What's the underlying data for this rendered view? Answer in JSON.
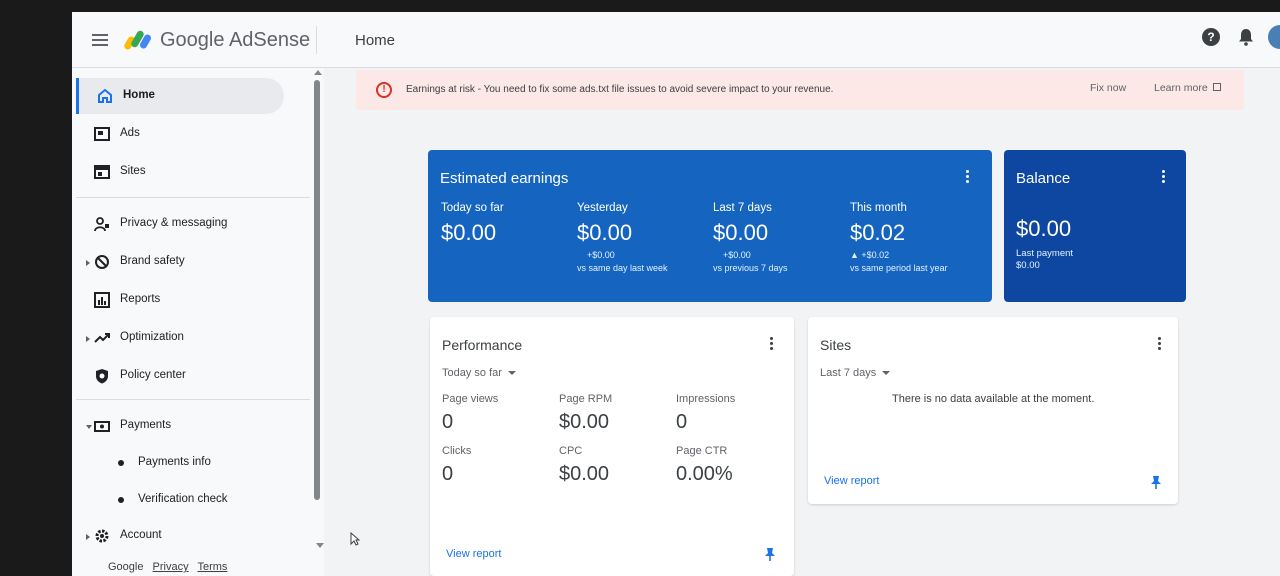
{
  "app": {
    "brand": "Google AdSense",
    "page_title": "Home",
    "help_glyph": "?"
  },
  "sidebar": {
    "items": [
      {
        "label": "Home",
        "icon": "home-icon"
      },
      {
        "label": "Ads",
        "icon": "ads-icon"
      },
      {
        "label": "Sites",
        "icon": "sites-icon"
      },
      {
        "label": "Privacy & messaging",
        "icon": "privacy-icon"
      },
      {
        "label": "Brand safety",
        "icon": "block-icon"
      },
      {
        "label": "Reports",
        "icon": "reports-icon"
      },
      {
        "label": "Optimization",
        "icon": "trending-icon"
      },
      {
        "label": "Policy center",
        "icon": "shield-icon"
      },
      {
        "label": "Payments",
        "icon": "payments-icon"
      },
      {
        "label": "Payments info",
        "icon": "bullet-icon"
      },
      {
        "label": "Verification check",
        "icon": "bullet-icon"
      },
      {
        "label": "Account",
        "icon": "gear-icon"
      }
    ],
    "footer": [
      "Google",
      "Privacy",
      "Terms"
    ]
  },
  "alert": {
    "glyph": "!",
    "text": "Earnings at risk - You need to fix some ads.txt file issues to avoid severe impact to your revenue.",
    "fix_label": "Fix now",
    "learn_label": "Learn more"
  },
  "earnings": {
    "title": "Estimated earnings",
    "metrics": [
      {
        "label": "Today so far",
        "value": "$0.00",
        "delta": "",
        "compare": ""
      },
      {
        "label": "Yesterday",
        "value": "$0.00",
        "delta": "+$0.00",
        "compare": "vs same day last week"
      },
      {
        "label": "Last 7 days",
        "value": "$0.00",
        "delta": "+$0.00",
        "compare": "vs previous 7 days"
      },
      {
        "label": "This month",
        "value": "$0.02",
        "delta": "▲ +$0.02",
        "compare": "vs same period last year"
      }
    ]
  },
  "balance": {
    "title": "Balance",
    "value": "$0.00",
    "last_payment_label": "Last payment",
    "last_payment_value": "$0.00"
  },
  "performance": {
    "title": "Performance",
    "range": "Today so far",
    "cells": [
      {
        "label": "Page views",
        "value": "0"
      },
      {
        "label": "Page RPM",
        "value": "$0.00"
      },
      {
        "label": "Impressions",
        "value": "0"
      },
      {
        "label": "Clicks",
        "value": "0"
      },
      {
        "label": "CPC",
        "value": "$0.00"
      },
      {
        "label": "Page CTR",
        "value": "0.00%"
      }
    ],
    "view_report": "View report"
  },
  "sites": {
    "title": "Sites",
    "range": "Last 7 days",
    "empty_text": "There is no data available at the moment.",
    "view_report": "View report"
  },
  "colors": {
    "accent": "#1a73e8",
    "earnings_card": "#1565c0",
    "balance_card": "#0d47a1",
    "alert_bg": "#fce8e6",
    "alert_icon": "#d93025"
  }
}
